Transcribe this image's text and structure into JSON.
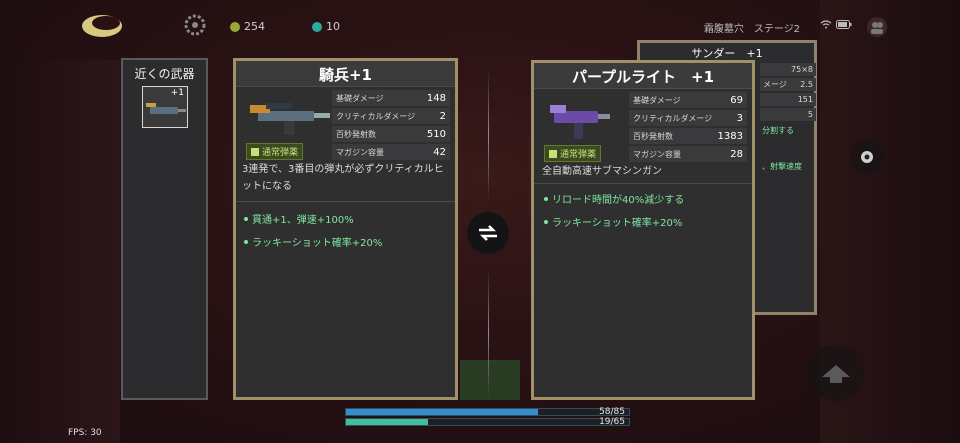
{
  "hud": {
    "coins": "254",
    "gems": "10",
    "location": "霜腹墓穴",
    "stage": "ステージ2",
    "fps": "FPS: 30"
  },
  "nearby": {
    "title": "近くの武器",
    "slot_level": "+1"
  },
  "left_card": {
    "title": "騎兵+1",
    "ammo": "通常弾薬",
    "stats": [
      {
        "label": "基礎ダメージ",
        "value": "148"
      },
      {
        "label": "クリティカルダメージ",
        "value": "2"
      },
      {
        "label": "百秒発射数",
        "value": "510"
      },
      {
        "label": "マガジン容量",
        "value": "42"
      }
    ],
    "description": "3連発で、3番目の弾丸が必ずクリティカルヒットになる",
    "effects": [
      "貫通+1、弾速+100%",
      "ラッキーショット確率+20%"
    ]
  },
  "right_card": {
    "title": "パープルライト　+1",
    "ammo": "通常弾薬",
    "stats": [
      {
        "label": "基礎ダメージ",
        "value": "69"
      },
      {
        "label": "クリティカルダメージ",
        "value": "3"
      },
      {
        "label": "百秒発射数",
        "value": "1383"
      },
      {
        "label": "マガジン容量",
        "value": "28"
      }
    ],
    "description": "全自動高速サブマシンガン",
    "effects": [
      "リロード時間が40%減少する",
      "ラッキーショット確率+20%"
    ]
  },
  "back_card": {
    "title": "サンダー　+1",
    "rows": [
      "75×8",
      "2.5",
      "151",
      "5"
    ],
    "row_label": "メージ",
    "line_a": "分割する",
    "line_b": "、射撃速度"
  },
  "bottom": {
    "hp_text": "58/85",
    "shield_text": "19/65",
    "hp_fraction": 0.68,
    "shield_fraction": 0.29
  },
  "colors": {
    "card_border": "#a0916a",
    "effect_green": "#7fe7a0",
    "ammo_green": "#c8e07a"
  }
}
